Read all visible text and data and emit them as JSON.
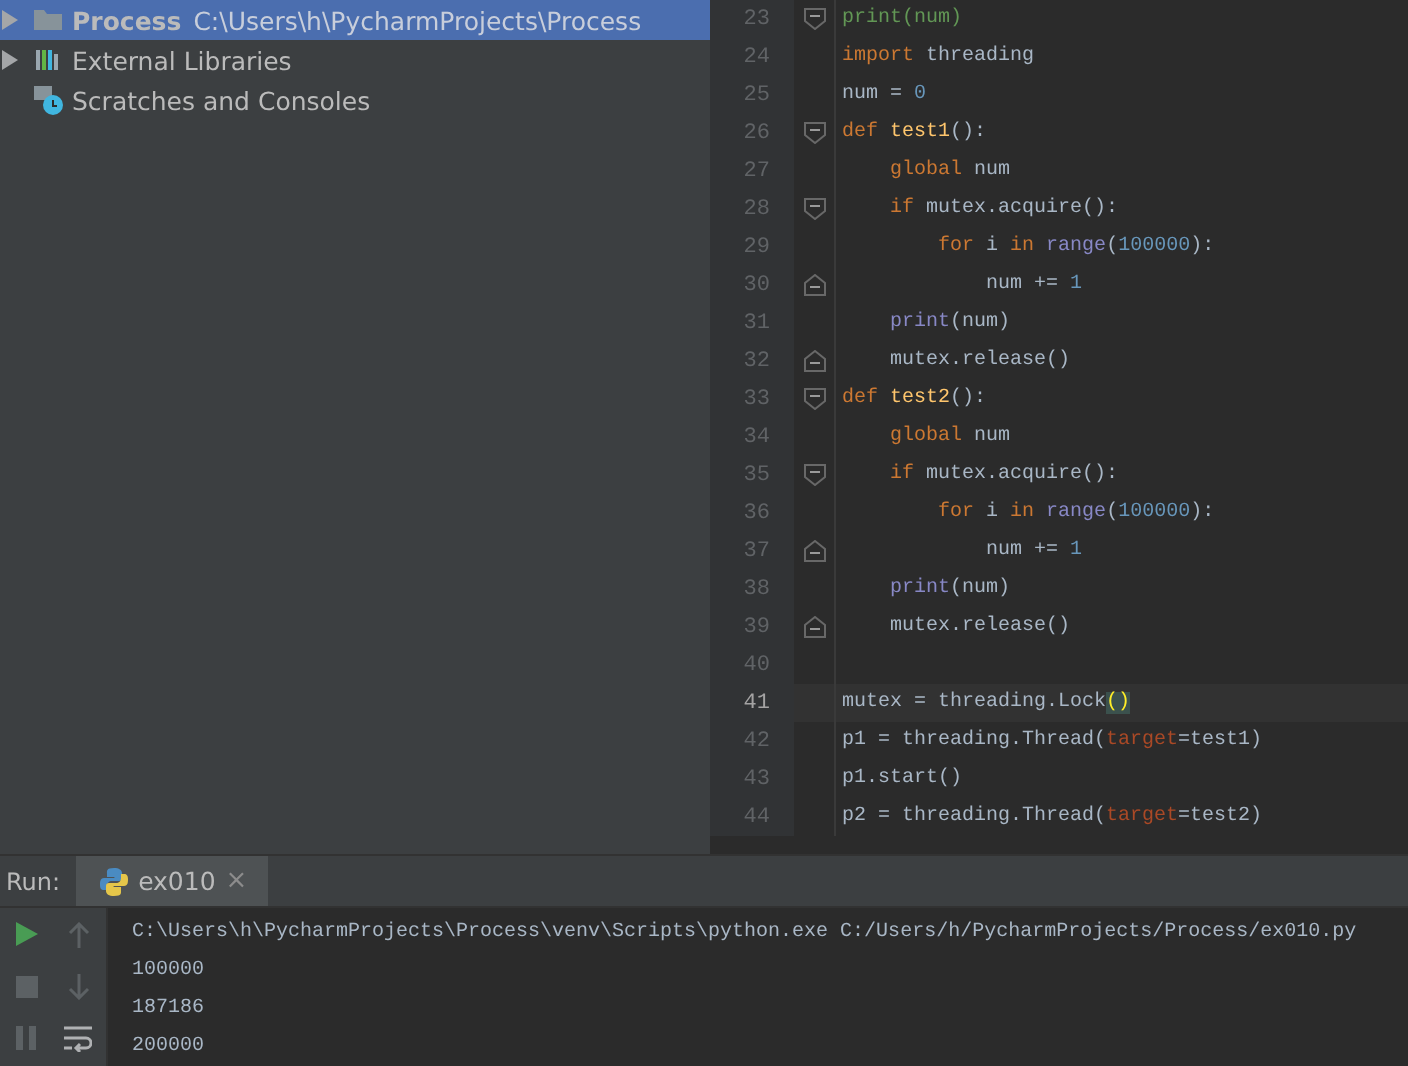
{
  "project_tree": {
    "items": [
      {
        "kind": "folder",
        "label": "Process",
        "path": "C:\\Users\\h\\PycharmProjects\\Process",
        "expandable": true,
        "selected": true
      },
      {
        "kind": "libraries",
        "label": "External Libraries",
        "expandable": true,
        "selected": false
      },
      {
        "kind": "scratches",
        "label": "Scratches and Consoles",
        "expandable": false,
        "selected": false
      }
    ]
  },
  "editor": {
    "lines": [
      {
        "number": "23",
        "fold_start": true,
        "fold_end": false,
        "current": false,
        "tokens": [
          {
            "kind": "green",
            "text": "print(num)"
          }
        ]
      },
      {
        "number": "24",
        "fold_start": false,
        "fold_end": false,
        "current": false,
        "tokens": [
          {
            "kind": "keyword",
            "text": "import"
          },
          {
            "kind": "plain",
            "text": " threading"
          }
        ]
      },
      {
        "number": "25",
        "fold_start": false,
        "fold_end": false,
        "current": false,
        "tokens": [
          {
            "kind": "plain",
            "text": "num = "
          },
          {
            "kind": "number",
            "text": "0"
          }
        ]
      },
      {
        "number": "26",
        "fold_start": true,
        "fold_end": false,
        "current": false,
        "tokens": [
          {
            "kind": "keyword",
            "text": "def"
          },
          {
            "kind": "function",
            "text": " test1"
          },
          {
            "kind": "plain",
            "text": "():"
          }
        ]
      },
      {
        "number": "27",
        "fold_start": false,
        "fold_end": false,
        "current": false,
        "tokens": [
          {
            "kind": "keyword",
            "text": "    global"
          },
          {
            "kind": "plain",
            "text": " num"
          }
        ]
      },
      {
        "number": "28",
        "fold_start": true,
        "fold_end": false,
        "current": false,
        "tokens": [
          {
            "kind": "keyword",
            "text": "    if"
          },
          {
            "kind": "plain",
            "text": " mutex.acquire():"
          }
        ]
      },
      {
        "number": "29",
        "fold_start": false,
        "fold_end": false,
        "current": false,
        "tokens": [
          {
            "kind": "keyword",
            "text": "        for"
          },
          {
            "kind": "plain",
            "text": " i "
          },
          {
            "kind": "keyword",
            "text": "in"
          },
          {
            "kind": "builtin",
            "text": " range"
          },
          {
            "kind": "plain",
            "text": "("
          },
          {
            "kind": "number",
            "text": "100000"
          },
          {
            "kind": "plain",
            "text": "):"
          }
        ]
      },
      {
        "number": "30",
        "fold_start": false,
        "fold_end": true,
        "current": false,
        "tokens": [
          {
            "kind": "plain",
            "text": "            num += "
          },
          {
            "kind": "number",
            "text": "1"
          }
        ]
      },
      {
        "number": "31",
        "fold_start": false,
        "fold_end": false,
        "current": false,
        "tokens": [
          {
            "kind": "builtin",
            "text": "    print"
          },
          {
            "kind": "plain",
            "text": "(num)"
          }
        ]
      },
      {
        "number": "32",
        "fold_start": false,
        "fold_end": true,
        "current": false,
        "tokens": [
          {
            "kind": "plain",
            "text": "    mutex.release()"
          }
        ]
      },
      {
        "number": "33",
        "fold_start": true,
        "fold_end": false,
        "current": false,
        "tokens": [
          {
            "kind": "keyword",
            "text": "def"
          },
          {
            "kind": "function",
            "text": " test2"
          },
          {
            "kind": "plain",
            "text": "():"
          }
        ]
      },
      {
        "number": "34",
        "fold_start": false,
        "fold_end": false,
        "current": false,
        "tokens": [
          {
            "kind": "keyword",
            "text": "    global"
          },
          {
            "kind": "plain",
            "text": " num"
          }
        ]
      },
      {
        "number": "35",
        "fold_start": true,
        "fold_end": false,
        "current": false,
        "tokens": [
          {
            "kind": "keyword",
            "text": "    if"
          },
          {
            "kind": "plain",
            "text": " mutex.acquire():"
          }
        ]
      },
      {
        "number": "36",
        "fold_start": false,
        "fold_end": false,
        "current": false,
        "tokens": [
          {
            "kind": "keyword",
            "text": "        for"
          },
          {
            "kind": "plain",
            "text": " i "
          },
          {
            "kind": "keyword",
            "text": "in"
          },
          {
            "kind": "builtin",
            "text": " range"
          },
          {
            "kind": "plain",
            "text": "("
          },
          {
            "kind": "number",
            "text": "100000"
          },
          {
            "kind": "plain",
            "text": "):"
          }
        ]
      },
      {
        "number": "37",
        "fold_start": false,
        "fold_end": true,
        "current": false,
        "tokens": [
          {
            "kind": "plain",
            "text": "            num += "
          },
          {
            "kind": "number",
            "text": "1"
          }
        ]
      },
      {
        "number": "38",
        "fold_start": false,
        "fold_end": false,
        "current": false,
        "tokens": [
          {
            "kind": "builtin",
            "text": "    print"
          },
          {
            "kind": "plain",
            "text": "(num)"
          }
        ]
      },
      {
        "number": "39",
        "fold_start": false,
        "fold_end": true,
        "current": false,
        "tokens": [
          {
            "kind": "plain",
            "text": "    mutex.release()"
          }
        ]
      },
      {
        "number": "40",
        "fold_start": false,
        "fold_end": false,
        "current": false
      },
      {
        "number": "41",
        "fold_start": false,
        "fold_end": false,
        "current": true,
        "tokens": [
          {
            "kind": "plain",
            "text": "mutex = threading.Lock"
          },
          {
            "kind": "match",
            "text": "()"
          }
        ]
      },
      {
        "number": "42",
        "fold_start": false,
        "fold_end": false,
        "current": false,
        "tokens": [
          {
            "kind": "plain",
            "text": "p1 = threading.Thread("
          },
          {
            "kind": "param",
            "text": "target"
          },
          {
            "kind": "plain",
            "text": "=test1)"
          }
        ]
      },
      {
        "number": "43",
        "fold_start": false,
        "fold_end": false,
        "current": false,
        "tokens": [
          {
            "kind": "plain",
            "text": "p1.start()"
          }
        ]
      },
      {
        "number": "44",
        "fold_start": false,
        "fold_end": false,
        "current": false,
        "tokens": [
          {
            "kind": "plain",
            "text": "p2 = threading.Thread("
          },
          {
            "kind": "param",
            "text": "target"
          },
          {
            "kind": "plain",
            "text": "=test2)"
          }
        ]
      }
    ]
  },
  "run_panel": {
    "title": "Run:",
    "tabs": [
      {
        "label": "ex010",
        "close": "×",
        "selected": true
      }
    ],
    "tools": [
      {
        "kind": "run",
        "disabled": false
      },
      {
        "kind": "up",
        "disabled": true
      },
      {
        "kind": "stop",
        "disabled": true
      },
      {
        "kind": "down",
        "disabled": true
      },
      {
        "kind": "pause",
        "disabled": true
      },
      {
        "kind": "wrap",
        "disabled": false
      }
    ],
    "output": [
      "C:\\Users\\h\\PycharmProjects\\Process\\venv\\Scripts\\python.exe C:/Users/h/PycharmProjects/Process/ex010.py",
      "100000",
      "187186",
      "200000"
    ]
  }
}
